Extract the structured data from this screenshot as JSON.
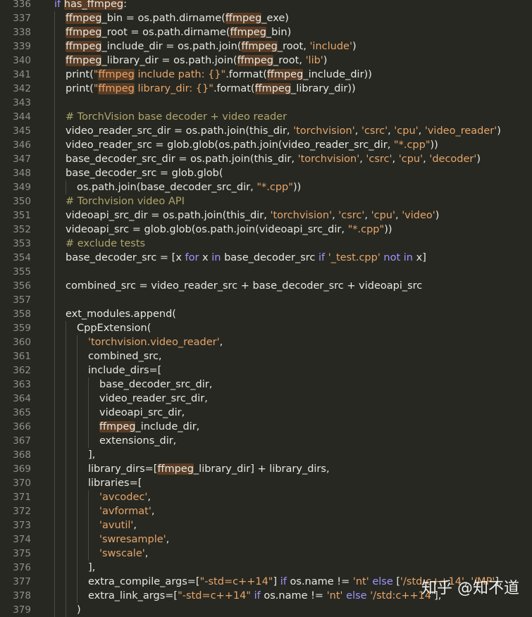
{
  "editor": {
    "lines": [
      {
        "n": "336",
        "i": 0,
        "t": [
          [
            "kw",
            "if "
          ],
          [
            "hl",
            "has_ffmpeg"
          ],
          [
            "p",
            ":"
          ]
        ]
      },
      {
        "n": "337",
        "i": 1,
        "t": [
          [
            "hl",
            "ffmpeg"
          ],
          [
            "id",
            "_bin = os.path.dirname("
          ],
          [
            "hl",
            "ffmpeg"
          ],
          [
            "id",
            "_exe)"
          ]
        ]
      },
      {
        "n": "338",
        "i": 1,
        "t": [
          [
            "hl",
            "ffmpeg"
          ],
          [
            "id",
            "_root = os.path.dirname("
          ],
          [
            "hl",
            "ffmpeg"
          ],
          [
            "id",
            "_bin)"
          ]
        ]
      },
      {
        "n": "339",
        "i": 1,
        "t": [
          [
            "hl",
            "ffmpeg"
          ],
          [
            "id",
            "_include_dir = os.path.join("
          ],
          [
            "hl",
            "ffmpeg"
          ],
          [
            "id",
            "_root, "
          ],
          [
            "str",
            "'include'"
          ],
          [
            "id",
            ")"
          ]
        ]
      },
      {
        "n": "340",
        "i": 1,
        "t": [
          [
            "hl",
            "ffmpeg"
          ],
          [
            "id",
            "_library_dir = os.path.join("
          ],
          [
            "hl",
            "ffmpeg"
          ],
          [
            "id",
            "_root, "
          ],
          [
            "str",
            "'lib'"
          ],
          [
            "id",
            ")"
          ]
        ]
      },
      {
        "n": "341",
        "i": 1,
        "t": [
          [
            "id",
            "print("
          ],
          [
            "str",
            "\""
          ],
          [
            "hls",
            "ffmpeg"
          ],
          [
            "str",
            " include path: {}\""
          ],
          [
            "id",
            ".format("
          ],
          [
            "hl",
            "ffmpeg"
          ],
          [
            "id",
            "_include_dir))"
          ]
        ]
      },
      {
        "n": "342",
        "i": 1,
        "t": [
          [
            "id",
            "print("
          ],
          [
            "str",
            "\""
          ],
          [
            "hls",
            "ffmpeg"
          ],
          [
            "str",
            " library_dir: {}\""
          ],
          [
            "id",
            ".format("
          ],
          [
            "hl",
            "ffmpeg"
          ],
          [
            "id",
            "_library_dir))"
          ]
        ]
      },
      {
        "n": "343",
        "i": 1,
        "t": []
      },
      {
        "n": "344",
        "i": 1,
        "t": [
          [
            "cm",
            "# TorchVision base decoder + video reader"
          ]
        ]
      },
      {
        "n": "345",
        "i": 1,
        "t": [
          [
            "id",
            "video_reader_src_dir = os.path.join(this_dir, "
          ],
          [
            "str",
            "'torchvision'"
          ],
          [
            "id",
            ", "
          ],
          [
            "str",
            "'csrc'"
          ],
          [
            "id",
            ", "
          ],
          [
            "str",
            "'cpu'"
          ],
          [
            "id",
            ", "
          ],
          [
            "str",
            "'video_reader'"
          ],
          [
            "id",
            ")"
          ]
        ]
      },
      {
        "n": "346",
        "i": 1,
        "t": [
          [
            "id",
            "video_reader_src = glob.glob(os.path.join(video_reader_src_dir, "
          ],
          [
            "str",
            "\"*.cpp\""
          ],
          [
            "id",
            "))"
          ]
        ]
      },
      {
        "n": "347",
        "i": 1,
        "t": [
          [
            "id",
            "base_decoder_src_dir = os.path.join(this_dir, "
          ],
          [
            "str",
            "'torchvision'"
          ],
          [
            "id",
            ", "
          ],
          [
            "str",
            "'csrc'"
          ],
          [
            "id",
            ", "
          ],
          [
            "str",
            "'cpu'"
          ],
          [
            "id",
            ", "
          ],
          [
            "str",
            "'decoder'"
          ],
          [
            "id",
            ")"
          ]
        ]
      },
      {
        "n": "348",
        "i": 1,
        "t": [
          [
            "id",
            "base_decoder_src = glob.glob("
          ]
        ]
      },
      {
        "n": "349",
        "i": 2,
        "t": [
          [
            "id",
            "os.path.join(base_decoder_src_dir, "
          ],
          [
            "str",
            "\"*.cpp\""
          ],
          [
            "id",
            "))"
          ]
        ]
      },
      {
        "n": "350",
        "i": 1,
        "t": [
          [
            "cm",
            "# Torchvision video API"
          ]
        ]
      },
      {
        "n": "351",
        "i": 1,
        "t": [
          [
            "id",
            "videoapi_src_dir = os.path.join(this_dir, "
          ],
          [
            "str",
            "'torchvision'"
          ],
          [
            "id",
            ", "
          ],
          [
            "str",
            "'csrc'"
          ],
          [
            "id",
            ", "
          ],
          [
            "str",
            "'cpu'"
          ],
          [
            "id",
            ", "
          ],
          [
            "str",
            "'video'"
          ],
          [
            "id",
            ")"
          ]
        ]
      },
      {
        "n": "352",
        "i": 1,
        "t": [
          [
            "id",
            "videoapi_src = glob.glob(os.path.join(videoapi_src_dir, "
          ],
          [
            "str",
            "\"*.cpp\""
          ],
          [
            "id",
            "))"
          ]
        ]
      },
      {
        "n": "353",
        "i": 1,
        "t": [
          [
            "cm",
            "# exclude tests"
          ]
        ]
      },
      {
        "n": "354",
        "i": 1,
        "t": [
          [
            "id",
            "base_decoder_src = [x "
          ],
          [
            "kw",
            "for"
          ],
          [
            "id",
            " x "
          ],
          [
            "kw",
            "in"
          ],
          [
            "id",
            " base_decoder_src "
          ],
          [
            "kw",
            "if"
          ],
          [
            "id",
            " "
          ],
          [
            "str",
            "'_test.cpp'"
          ],
          [
            "id",
            " "
          ],
          [
            "kw",
            "not in"
          ],
          [
            "id",
            " x]"
          ]
        ]
      },
      {
        "n": "355",
        "i": 1,
        "t": []
      },
      {
        "n": "356",
        "i": 1,
        "t": [
          [
            "id",
            "combined_src = video_reader_src + base_decoder_src + videoapi_src"
          ]
        ]
      },
      {
        "n": "357",
        "i": 1,
        "t": []
      },
      {
        "n": "358",
        "i": 1,
        "t": [
          [
            "id",
            "ext_modules.append("
          ]
        ]
      },
      {
        "n": "359",
        "i": 2,
        "t": [
          [
            "id",
            "CppExtension("
          ]
        ]
      },
      {
        "n": "360",
        "i": 3,
        "t": [
          [
            "str",
            "'torchvision.video_reader'"
          ],
          [
            "id",
            ","
          ]
        ]
      },
      {
        "n": "361",
        "i": 3,
        "t": [
          [
            "id",
            "combined_src,"
          ]
        ]
      },
      {
        "n": "362",
        "i": 3,
        "t": [
          [
            "id",
            "include_dirs=["
          ]
        ]
      },
      {
        "n": "363",
        "i": 4,
        "t": [
          [
            "id",
            "base_decoder_src_dir,"
          ]
        ]
      },
      {
        "n": "364",
        "i": 4,
        "t": [
          [
            "id",
            "video_reader_src_dir,"
          ]
        ]
      },
      {
        "n": "365",
        "i": 4,
        "t": [
          [
            "id",
            "videoapi_src_dir,"
          ]
        ]
      },
      {
        "n": "366",
        "i": 4,
        "t": [
          [
            "hl",
            "ffmpeg"
          ],
          [
            "id",
            "_include_dir,"
          ]
        ]
      },
      {
        "n": "367",
        "i": 4,
        "t": [
          [
            "id",
            "extensions_dir,"
          ]
        ]
      },
      {
        "n": "368",
        "i": 3,
        "t": [
          [
            "id",
            "],"
          ]
        ]
      },
      {
        "n": "369",
        "i": 3,
        "t": [
          [
            "id",
            "library_dirs=["
          ],
          [
            "hl",
            "ffmpeg"
          ],
          [
            "id",
            "_library_dir] + library_dirs,"
          ]
        ]
      },
      {
        "n": "370",
        "i": 3,
        "t": [
          [
            "id",
            "libraries=["
          ]
        ]
      },
      {
        "n": "371",
        "i": 4,
        "t": [
          [
            "str",
            "'avcodec'"
          ],
          [
            "id",
            ","
          ]
        ]
      },
      {
        "n": "372",
        "i": 4,
        "t": [
          [
            "str",
            "'avformat'"
          ],
          [
            "id",
            ","
          ]
        ]
      },
      {
        "n": "373",
        "i": 4,
        "t": [
          [
            "str",
            "'avutil'"
          ],
          [
            "id",
            ","
          ]
        ]
      },
      {
        "n": "374",
        "i": 4,
        "t": [
          [
            "str",
            "'swresample'"
          ],
          [
            "id",
            ","
          ]
        ]
      },
      {
        "n": "375",
        "i": 4,
        "t": [
          [
            "str",
            "'swscale'"
          ],
          [
            "id",
            ","
          ]
        ]
      },
      {
        "n": "376",
        "i": 3,
        "t": [
          [
            "id",
            "],"
          ]
        ]
      },
      {
        "n": "377",
        "i": 3,
        "t": [
          [
            "id",
            "extra_compile_args=["
          ],
          [
            "str",
            "\"-std=c++14\""
          ],
          [
            "id",
            "] "
          ],
          [
            "kw",
            "if"
          ],
          [
            "id",
            " os.name != "
          ],
          [
            "str",
            "'nt'"
          ],
          [
            "id",
            " "
          ],
          [
            "kw",
            "else"
          ],
          [
            "id",
            " ["
          ],
          [
            "str",
            "'/std:c++14'"
          ],
          [
            "id",
            ", "
          ],
          [
            "str",
            "'/MP'"
          ],
          [
            "id",
            "],"
          ]
        ]
      },
      {
        "n": "378",
        "i": 3,
        "t": [
          [
            "id",
            "extra_link_args=["
          ],
          [
            "str",
            "\"-std=c++14\""
          ],
          [
            "id",
            " "
          ],
          [
            "kw",
            "if"
          ],
          [
            "id",
            " os.name != "
          ],
          [
            "str",
            "'nt'"
          ],
          [
            "id",
            " "
          ],
          [
            "kw",
            "else"
          ],
          [
            "id",
            " "
          ],
          [
            "str",
            "'/std:c++14'"
          ],
          [
            "id",
            "],"
          ]
        ]
      },
      {
        "n": "379",
        "i": 2,
        "t": [
          [
            "id",
            ")"
          ]
        ]
      }
    ]
  },
  "watermark": "知乎 @知不道"
}
